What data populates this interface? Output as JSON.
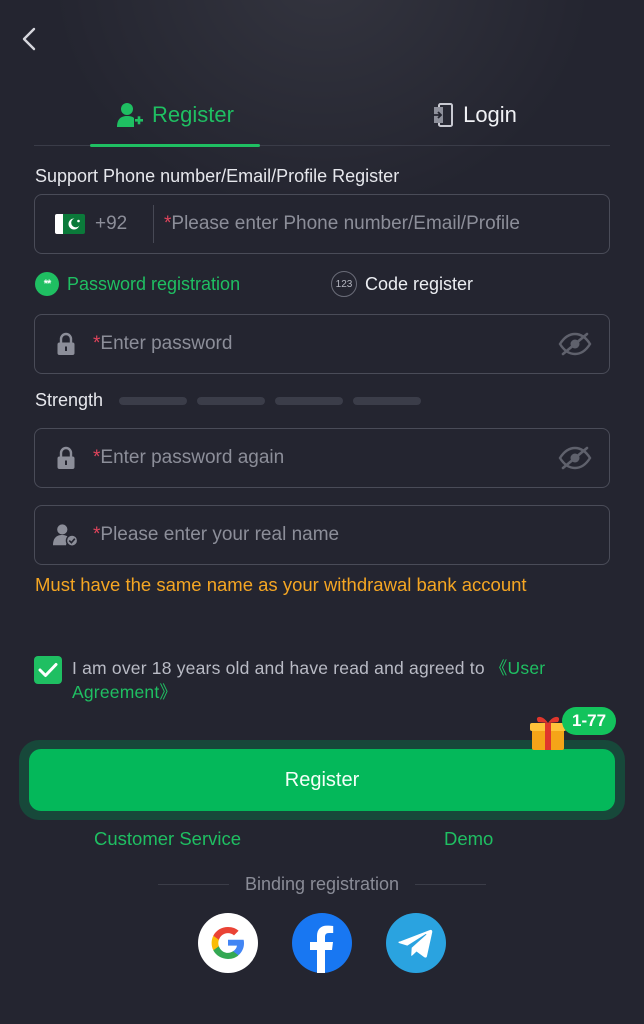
{
  "tabs": {
    "register": "Register",
    "login": "Login"
  },
  "form": {
    "support_label": "Support Phone number/Email/Profile Register",
    "country_code": "+92",
    "required_mark": "*",
    "account_placeholder": "Please enter Phone number/Email/Profile",
    "mode_password": "Password registration",
    "mode_code": "Code register",
    "mode_password_icon_text": "**",
    "mode_code_icon_text": "123",
    "password_placeholder": "Enter password",
    "strength_label": "Strength",
    "strength_level": 0,
    "strength_segments": 4,
    "password_again_placeholder": "Enter password again",
    "real_name_placeholder": "Please enter your real name",
    "name_note": "Must have the same name as your withdrawal bank account",
    "agree_text": "I am over 18 years old and have read and agreed to ",
    "agree_link": "《User Agreement》",
    "agree_checked": true
  },
  "register_button": {
    "label": "Register",
    "badge": "1-77"
  },
  "links": {
    "customer_service": "Customer Service",
    "demo": "Demo"
  },
  "binding": {
    "title": "Binding registration",
    "providers": [
      "google-icon",
      "facebook-icon",
      "telegram-icon"
    ]
  },
  "colors": {
    "accent": "#1fbf62",
    "warning": "#f5a623",
    "background": "#242530",
    "required": "#e0445c"
  }
}
